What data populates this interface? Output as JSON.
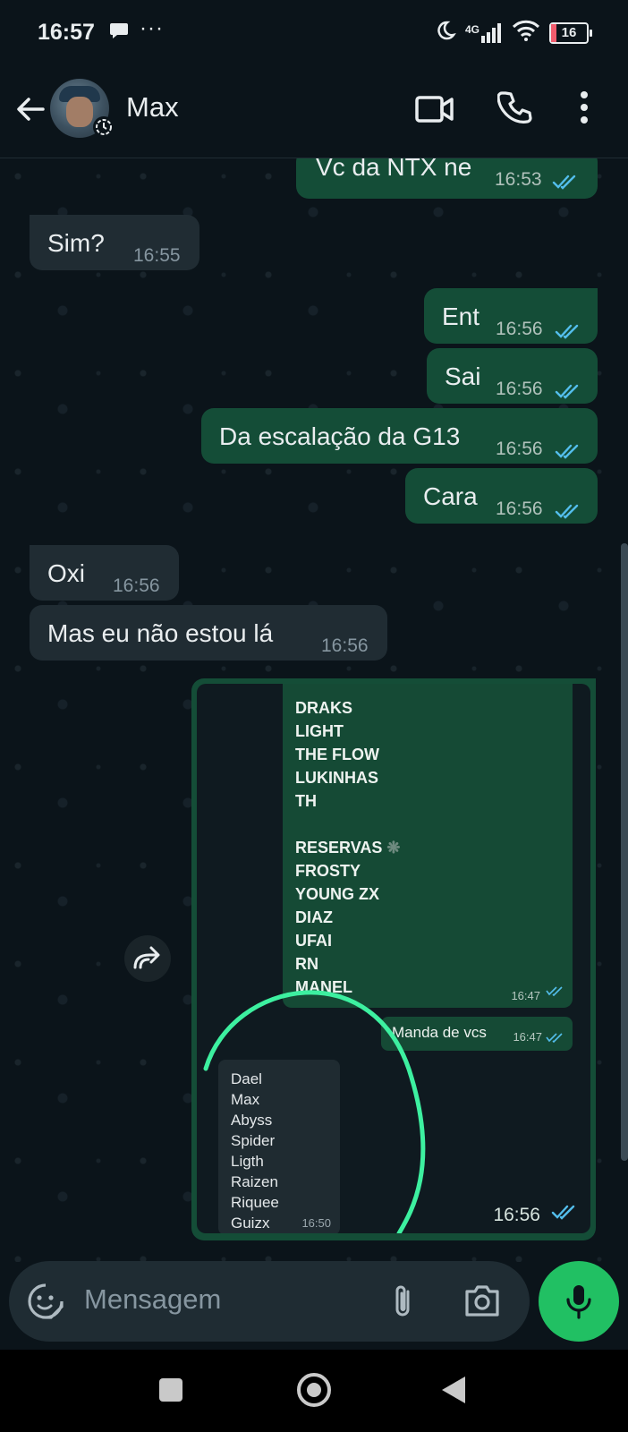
{
  "status_bar": {
    "time": "16:57",
    "network": "4G",
    "battery": "16"
  },
  "header": {
    "contact_name": "Max"
  },
  "messages": [
    {
      "id": "m1",
      "dir": "out",
      "text": "Vc da NTX ne",
      "time": "16:53"
    },
    {
      "id": "m2",
      "dir": "in",
      "text": "Sim?",
      "time": "16:55"
    },
    {
      "id": "m3",
      "dir": "out",
      "text": "Ent",
      "time": "16:56"
    },
    {
      "id": "m4",
      "dir": "out",
      "text": "Sai",
      "time": "16:56"
    },
    {
      "id": "m5",
      "dir": "out",
      "text": "Da escalação da G13",
      "time": "16:56"
    },
    {
      "id": "m6",
      "dir": "out",
      "text": "Cara",
      "time": "16:56"
    },
    {
      "id": "m7",
      "dir": "in",
      "text": "Oxi",
      "time": "16:56"
    },
    {
      "id": "m8",
      "dir": "in",
      "text": "Mas eu não estou lá",
      "time": "16:56"
    }
  ],
  "image_message": {
    "time": "16:56",
    "screenshot": {
      "roster_lines": [
        "DRAKS",
        "LIGHT",
        "THE FLOW",
        "LUKINHAS",
        "TH",
        "",
        "RESERVAS",
        "FROSTY",
        "YOUNG ZX",
        "DIAZ",
        "UFAI",
        "RN",
        "MANEL"
      ],
      "roster_time": "16:47",
      "manda_text": "Manda de vcs",
      "manda_time": "16:47",
      "list_names": [
        "Dael",
        "Max",
        "Abyss",
        "Spider",
        "Ligth",
        "Raizen",
        "Riquee",
        "Guizx"
      ],
      "list_time": "16:50"
    }
  },
  "composer": {
    "placeholder": "Mensagem"
  },
  "colors": {
    "outgoing": "#144d37",
    "incoming": "#202c33",
    "accent": "#21c063",
    "read_ticks": "#53bdeb"
  }
}
